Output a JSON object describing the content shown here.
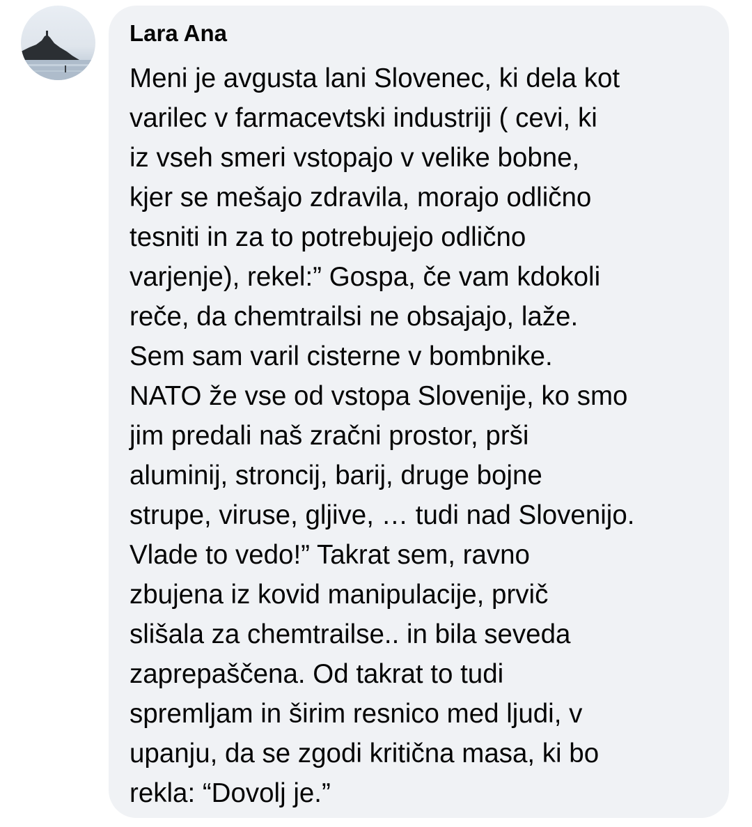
{
  "comment": {
    "author": "Lara Ana",
    "lines": [
      "Meni je avgusta lani Slovenec, ki dela kot",
      "varilec v farmacevtski industriji ( cevi, ki",
      "iz vseh smeri vstopajo v velike bobne,",
      "kjer se mešajo zdravila, morajo odlično",
      "tesniti in za to potrebujejo odlično",
      "varjenje), rekel:” Gospa, če vam kdokoli",
      "reče, da chemtrailsi ne obsajajo, laže.",
      "Sem sam varil cisterne v bombnike.",
      "NATO že vse od vstopa Slovenije, ko smo",
      "jim predali naš zračni prostor, prši",
      "aluminij, stroncij, barij, druge bojne",
      "strupe, viruse, gljive, … tudi nad Slovenijo.",
      "Vlade to vedo!” Takrat sem, ravno",
      "zbujena iz kovid manipulacije, prvič",
      "slišala za chemtrailse.. in bila seveda",
      "zaprepaščena. Od takrat to tudi",
      "spremljam in širim resnico med ljudi, v",
      "upanju, da se zgodi kritična masa, ki bo",
      "rekla: “Dovolj je.”"
    ]
  },
  "colors": {
    "bubble_background": "#f0f2f5",
    "text": "#050505",
    "page_background": "#ffffff"
  }
}
